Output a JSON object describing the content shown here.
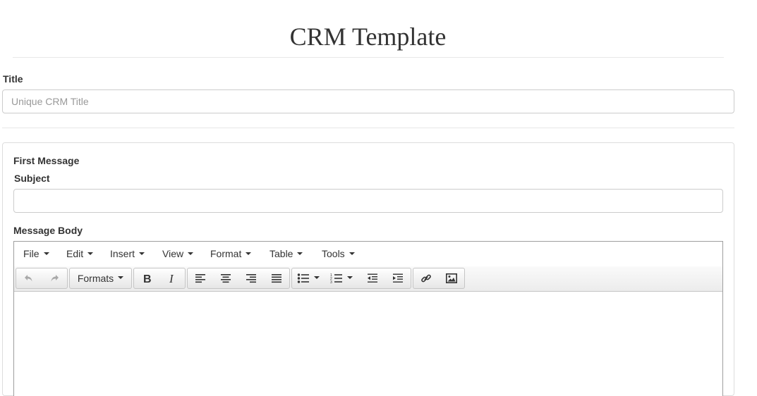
{
  "page": {
    "title": "CRM Template"
  },
  "title_field": {
    "label": "Title",
    "value": "",
    "placeholder": "Unique CRM Title"
  },
  "first_message": {
    "heading": "First Message",
    "subject_label": "Subject",
    "subject_value": "",
    "body_label": "Message Body"
  },
  "editor": {
    "menu": [
      {
        "label": "File"
      },
      {
        "label": "Edit"
      },
      {
        "label": "Insert"
      },
      {
        "label": "View"
      },
      {
        "label": "Format"
      },
      {
        "label": "Table"
      },
      {
        "label": "Tools"
      }
    ],
    "toolbar": {
      "undo_icon": "undo-icon",
      "redo_icon": "redo-icon",
      "formats_label": "Formats",
      "bold_icon": "bold-icon",
      "italic_icon": "italic-icon",
      "align_icons": [
        "align-left-icon",
        "align-center-icon",
        "align-right-icon",
        "align-justify-icon"
      ],
      "list_icons": [
        "bullet-list-icon",
        "numbered-list-icon"
      ],
      "indent_icons": [
        "outdent-icon",
        "indent-icon"
      ],
      "insert_icons": [
        "link-icon",
        "image-icon"
      ]
    },
    "content": ""
  }
}
